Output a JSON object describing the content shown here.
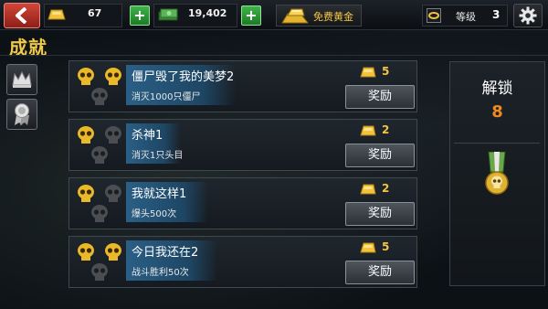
{
  "header": {
    "gold_amount": "67",
    "cash_amount": "19,402",
    "free_gold_label": "免费黄金",
    "level_label": "等级",
    "level_value": "3"
  },
  "page_title": "成就",
  "achievements": [
    {
      "name": "僵尸毁了我的美梦2",
      "desc": "消灭1000只僵尸",
      "reward": "5",
      "button": "奖励",
      "skulls_earned": 2
    },
    {
      "name": "杀神1",
      "desc": "消灭1只头目",
      "reward": "2",
      "button": "奖励",
      "skulls_earned": 1
    },
    {
      "name": "我就这样1",
      "desc": "爆头500次",
      "reward": "2",
      "button": "奖励",
      "skulls_earned": 1
    },
    {
      "name": "今日我还在2",
      "desc": "战斗胜利50次",
      "reward": "5",
      "button": "奖励",
      "skulls_earned": 2
    }
  ],
  "unlock_panel": {
    "label": "解锁",
    "count": "8"
  },
  "colors": {
    "gold": "#f5c542",
    "accent_orange": "#f08a1e",
    "name_highlight": "#2a5f86",
    "back_red": "#c73a2f",
    "plus_green": "#2f9c3a"
  },
  "icons": [
    "back-arrow-icon",
    "gold-bar-icon",
    "cash-stack-icon",
    "plus-icon",
    "gold-pile-icon",
    "level-ring-icon",
    "gear-icon",
    "crown-icon",
    "medal-ribbon-icon",
    "skull-icon"
  ]
}
